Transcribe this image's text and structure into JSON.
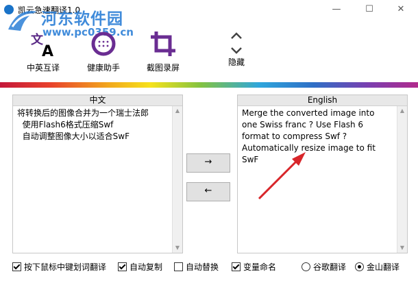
{
  "window": {
    "title": "凯云急速翻译1.0",
    "minimize": "—",
    "maximize": "☐",
    "close": "✕"
  },
  "watermark": {
    "site_name": "河东软件园",
    "url": "www.pc0359.cn"
  },
  "toolbar": {
    "items": [
      {
        "label": "中英互译",
        "icon": "translate-icon"
      },
      {
        "label": "健康助手",
        "icon": "health-assistant-icon"
      },
      {
        "label": "截图录屏",
        "icon": "crop-icon"
      },
      {
        "label": "隐藏",
        "icon": "hide-chevrons-icon"
      }
    ]
  },
  "source_panel": {
    "header": "中文",
    "text": "将转换后的图像合并为一个瑞士法郎\n  使用Flash6格式压缩Swf\n  自动调整图像大小以适合SwF"
  },
  "target_panel": {
    "header": "English",
    "text": "Merge the converted image into\none Swiss franc ? Use Flash 6\nformat to compress Swf ?\nAutomatically resize image to fit\nSwF"
  },
  "buttons": {
    "to_english": "→",
    "to_chinese": "←"
  },
  "options": {
    "middle_click_translate": {
      "label": "按下鼠标中键划词翻译",
      "checked": true
    },
    "auto_copy": {
      "label": "自动复制",
      "checked": true
    },
    "auto_replace": {
      "label": "自动替换",
      "checked": false
    },
    "variable_naming": {
      "label": "变量命名",
      "checked": true
    },
    "google_translate": {
      "label": "谷歌翻译",
      "selected": false
    },
    "kingsoft_translate": {
      "label": "金山翻译",
      "selected": true
    }
  },
  "colors": {
    "accent": "#7a2f9e",
    "annotation_arrow": "#d8262a",
    "watermark": "#2c7fd6"
  }
}
